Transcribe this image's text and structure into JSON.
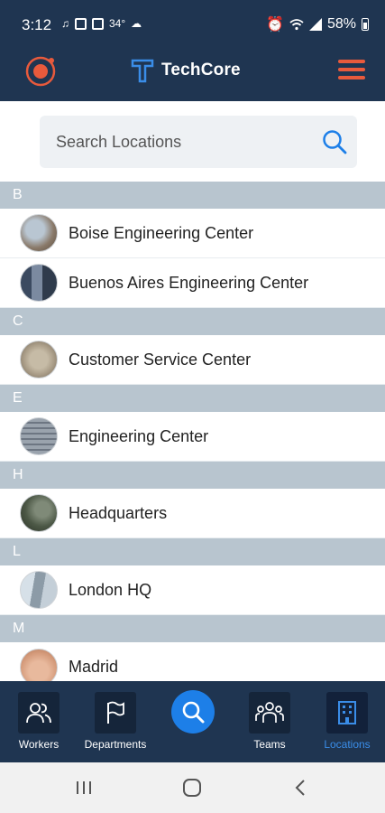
{
  "status_bar": {
    "time": "3:12",
    "temperature": "34°",
    "battery": "58%",
    "icons": [
      "notification-icon",
      "app-icon",
      "gallery-icon",
      "cloud-icon",
      "alarm-icon",
      "wifi-icon",
      "signal-icon",
      "battery-icon"
    ]
  },
  "app_bar": {
    "brand_title": "TechCore",
    "colors": {
      "background": "#1f3551",
      "accent": "#e85a3c",
      "brand_blue": "#3a8de8"
    }
  },
  "search": {
    "placeholder": "Search Locations"
  },
  "sections": [
    {
      "letter": "B",
      "items": [
        {
          "label": "Boise Engineering Center",
          "avatar_color": "#8a7a6a"
        },
        {
          "label": "Buenos Aires Engineering Center",
          "avatar_color": "#5b6a7d"
        }
      ]
    },
    {
      "letter": "C",
      "items": [
        {
          "label": "Customer Service Center",
          "avatar_color": "#a89b86"
        }
      ]
    },
    {
      "letter": "E",
      "items": [
        {
          "label": "Engineering Center",
          "avatar_color": "#7f8893"
        }
      ]
    },
    {
      "letter": "H",
      "items": [
        {
          "label": "Headquarters",
          "avatar_color": "#4c5846"
        }
      ]
    },
    {
      "letter": "L",
      "items": [
        {
          "label": "London HQ",
          "avatar_color": "#8c9ba7"
        }
      ]
    },
    {
      "letter": "M",
      "items": [
        {
          "label": "Madrid",
          "avatar_color": "#d49a7a"
        }
      ]
    }
  ],
  "bottom_nav": {
    "items": [
      {
        "label": "Workers",
        "icon": "workers-icon"
      },
      {
        "label": "Departments",
        "icon": "flag-icon"
      },
      {
        "label": "",
        "icon": "search-icon"
      },
      {
        "label": "Teams",
        "icon": "teams-icon"
      },
      {
        "label": "Locations",
        "icon": "building-icon",
        "active": true
      }
    ]
  },
  "system_nav": {
    "icons": [
      "recents-icon",
      "home-icon",
      "back-icon"
    ]
  }
}
